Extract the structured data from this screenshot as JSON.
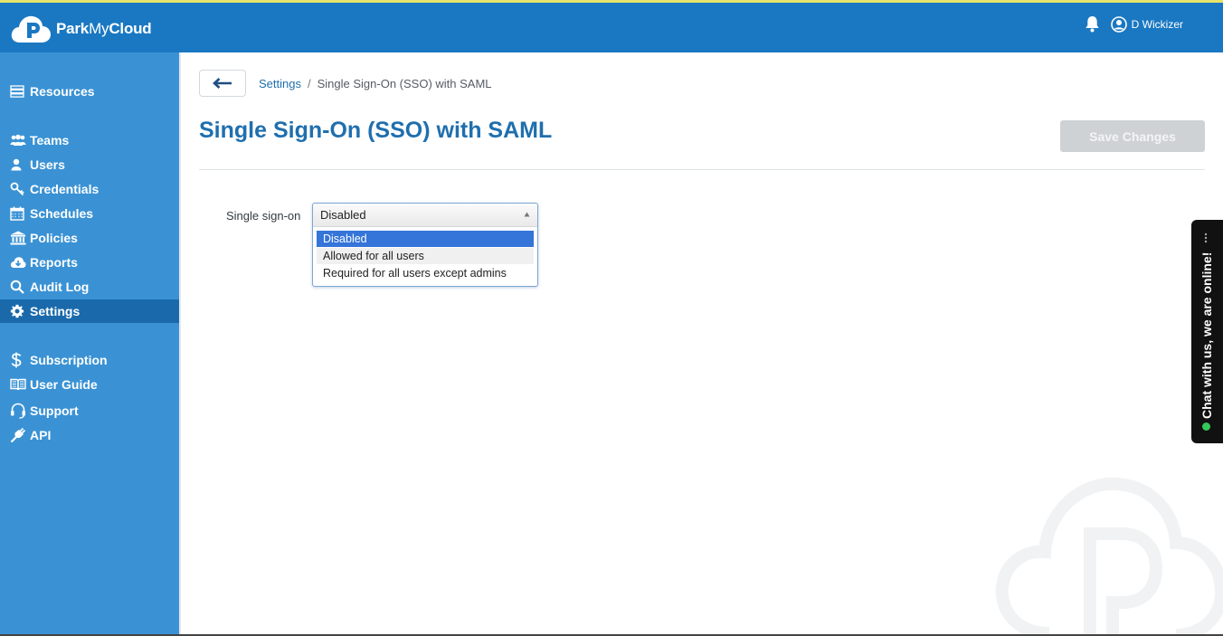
{
  "header": {
    "brand_bold": "Park",
    "brand_light": "My",
    "brand_end": "Cloud",
    "user_name": "D Wickizer",
    "icons": [
      "bell-icon",
      "user-circle-icon"
    ],
    "color": "#1a78c2"
  },
  "sidebar": {
    "color": "#3a92d4",
    "active_color": "#1a6aab",
    "items": [
      {
        "label": "Resources",
        "icon": "server-icon"
      },
      {
        "label": "Teams",
        "icon": "users-group-icon"
      },
      {
        "label": "Users",
        "icon": "user-icon"
      },
      {
        "label": "Credentials",
        "icon": "key-icon"
      },
      {
        "label": "Schedules",
        "icon": "calendar-icon"
      },
      {
        "label": "Policies",
        "icon": "bank-icon"
      },
      {
        "label": "Reports",
        "icon": "cloud-download-icon"
      },
      {
        "label": "Audit Log",
        "icon": "search-icon"
      },
      {
        "label": "Settings",
        "icon": "gear-icon",
        "active": true
      },
      {
        "label": "Subscription",
        "icon": "dollar-icon"
      },
      {
        "label": "User Guide",
        "icon": "book-icon"
      },
      {
        "label": "Support",
        "icon": "headset-icon"
      },
      {
        "label": "API",
        "icon": "plug-icon"
      }
    ]
  },
  "breadcrumb": {
    "parent": "Settings",
    "separator": "/",
    "current": "Single Sign-On (SSO) with SAML"
  },
  "page": {
    "title": "Single Sign-On (SSO) with SAML",
    "save_label": "Save Changes"
  },
  "sso_field": {
    "label": "Single sign-on",
    "selected": "Disabled",
    "options": [
      "Disabled",
      "Allowed for all users",
      "Required for all users except admins"
    ]
  },
  "chat": {
    "text": "Chat with us, we are online!",
    "status_color": "#34c759"
  }
}
